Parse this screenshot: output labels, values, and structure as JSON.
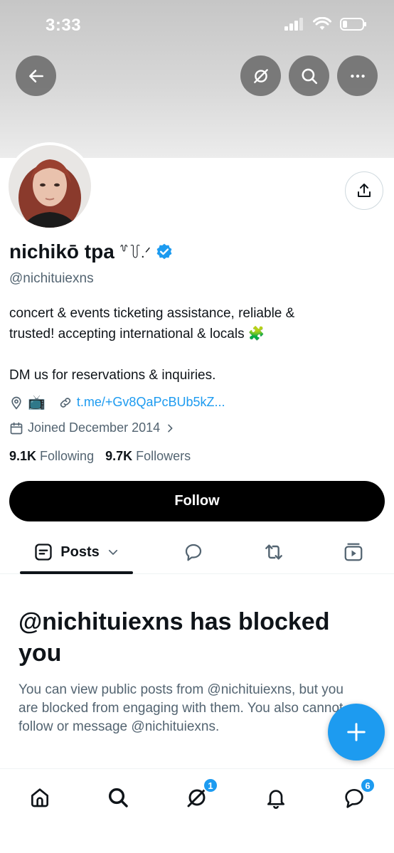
{
  "status_bar": {
    "time": "3:33"
  },
  "profile": {
    "display_name": "nichikō tpa",
    "name_decoration": "꒷꒦.ᐟ",
    "handle": "@nichituiexns",
    "bio_lines": [
      "concert & events ticketing assistance, reliable &",
      "trusted! accepting international & locals 🧩",
      "",
      "DM us for reservations & inquiries."
    ],
    "location_emoji": "📺",
    "link": "t.me/+Gv8QaPcBUb5kZ...",
    "joined": "Joined December 2014",
    "following_count": "9.1K",
    "following_label": "Following",
    "followers_count": "9.7K",
    "followers_label": "Followers"
  },
  "actions": {
    "follow_label": "Follow"
  },
  "tabs": {
    "posts_label": "Posts"
  },
  "blocked": {
    "title": "@nichituiexns has blocked you",
    "body": "You can view public posts from @nichituiexns, but you are blocked from engaging with them. You also cannot follow or message @nichituiexns."
  },
  "bottom_nav": {
    "grok_badge": "1",
    "messages_badge": "6"
  },
  "colors": {
    "accent": "#1d9bf0",
    "text": "#0f1419",
    "secondary": "#536471"
  }
}
